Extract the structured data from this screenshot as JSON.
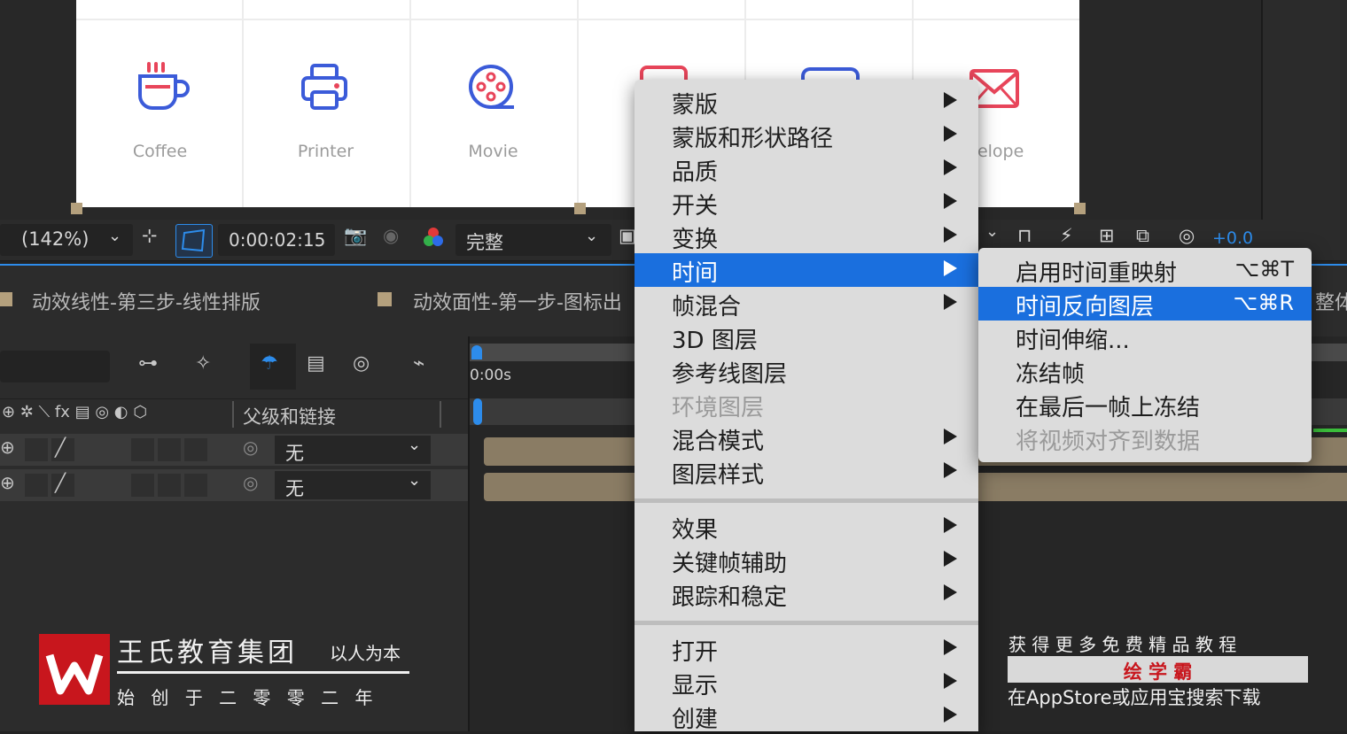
{
  "composition": {
    "tiles": [
      {
        "label": "Coffee",
        "icon": "coffee-cup-icon"
      },
      {
        "label": "Printer",
        "icon": "printer-icon"
      },
      {
        "label": "Movie",
        "icon": "film-reel-icon"
      },
      {
        "label": "",
        "icon": "partial-icon"
      },
      {
        "label": "",
        "icon": "partial-icon"
      },
      {
        "label": "velope",
        "icon": "envelope-icon"
      }
    ]
  },
  "viewer_toolbar": {
    "zoom": "(142%)",
    "timecode": "0:00:02:15",
    "resolution": "完整",
    "exposure": "+0.0",
    "colors": {
      "exposure": "#2d8ceb",
      "accent": "#2d8ceb"
    }
  },
  "timeline": {
    "tabs": [
      "动效线性-第三步-线性排版",
      "动效面性-第一步-图标出",
      "整体"
    ],
    "parent_column_header": "父级和链接",
    "time_zero": "0:00s",
    "layers": [
      {
        "parent": "无"
      },
      {
        "parent": "无"
      }
    ]
  },
  "context_menu": {
    "groups": [
      [
        {
          "label": "蒙版",
          "submenu": true
        },
        {
          "label": "蒙版和形状路径",
          "submenu": true
        },
        {
          "label": "品质",
          "submenu": true
        },
        {
          "label": "开关",
          "submenu": true
        },
        {
          "label": "变换",
          "submenu": true
        },
        {
          "label": "时间",
          "submenu": true,
          "selected": true
        },
        {
          "label": "帧混合",
          "submenu": true
        },
        {
          "label": "3D 图层",
          "submenu": false
        },
        {
          "label": "参考线图层",
          "submenu": false
        },
        {
          "label": "环境图层",
          "submenu": false,
          "disabled": true
        },
        {
          "label": "混合模式",
          "submenu": true
        },
        {
          "label": "图层样式",
          "submenu": true
        }
      ],
      [
        {
          "label": "效果",
          "submenu": true
        },
        {
          "label": "关键帧辅助",
          "submenu": true
        },
        {
          "label": "跟踪和稳定",
          "submenu": true
        }
      ],
      [
        {
          "label": "打开",
          "submenu": true
        },
        {
          "label": "显示",
          "submenu": true
        },
        {
          "label": "创建",
          "submenu": true
        }
      ]
    ],
    "selected_color": "#1a6fde"
  },
  "time_submenu": {
    "items": [
      {
        "label": "启用时间重映射",
        "shortcut": "⌥⌘T"
      },
      {
        "label": "时间反向图层",
        "shortcut": "⌥⌘R",
        "selected": true
      },
      {
        "label": "时间伸缩...",
        "shortcut": ""
      },
      {
        "label": "冻结帧",
        "shortcut": ""
      },
      {
        "label": "在最后一帧上冻结",
        "shortcut": ""
      },
      {
        "label": "将视频对齐到数据",
        "shortcut": "",
        "disabled": true
      }
    ]
  },
  "watermark_left": {
    "title": "王氏教育集团",
    "slogan": "以人为本",
    "subtitle": "始 创 于 二 零 零 二 年",
    "logo_color": "#c8161d"
  },
  "watermark_right": {
    "line1": "获 得 更 多 免 费 精 品 教 程",
    "brand": "绘 学 霸",
    "line3": "在AppStore或应用宝搜索下载",
    "brand_color": "#c8161d"
  }
}
